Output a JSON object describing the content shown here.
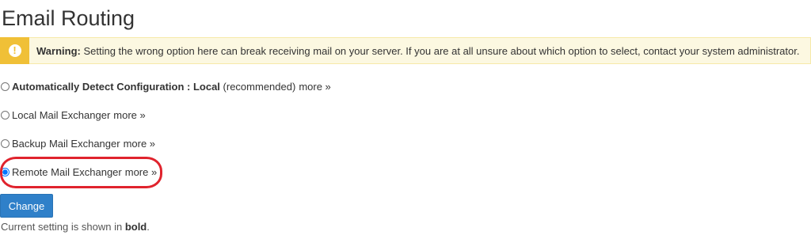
{
  "page": {
    "title": "Email Routing"
  },
  "warning": {
    "label": "Warning:",
    "message": "Setting the wrong option here can break receiving mail on your server. If you are at all unsure about which option to select, contact your system administrator.",
    "icon": "exclamation-icon",
    "icon_glyph": "!",
    "accent_color": "#f0c037",
    "background_color": "#fcf8e1"
  },
  "options": [
    {
      "label_bold": "Automatically Detect Configuration : Local",
      "label_suffix": "(recommended)",
      "more": "more »",
      "selected": false
    },
    {
      "label": "Local Mail Exchanger",
      "more": "more »",
      "selected": false
    },
    {
      "label": "Backup Mail Exchanger",
      "more": "more »",
      "selected": false
    },
    {
      "label": "Remote Mail Exchanger",
      "more": "more »",
      "selected": true
    }
  ],
  "annotation": {
    "highlight_color": "#e0232d"
  },
  "actions": {
    "change_label": "Change",
    "button_color": "#2f80c9"
  },
  "footnote": {
    "prefix": "Current setting is shown in",
    "bold_word": "bold",
    "suffix": "."
  }
}
